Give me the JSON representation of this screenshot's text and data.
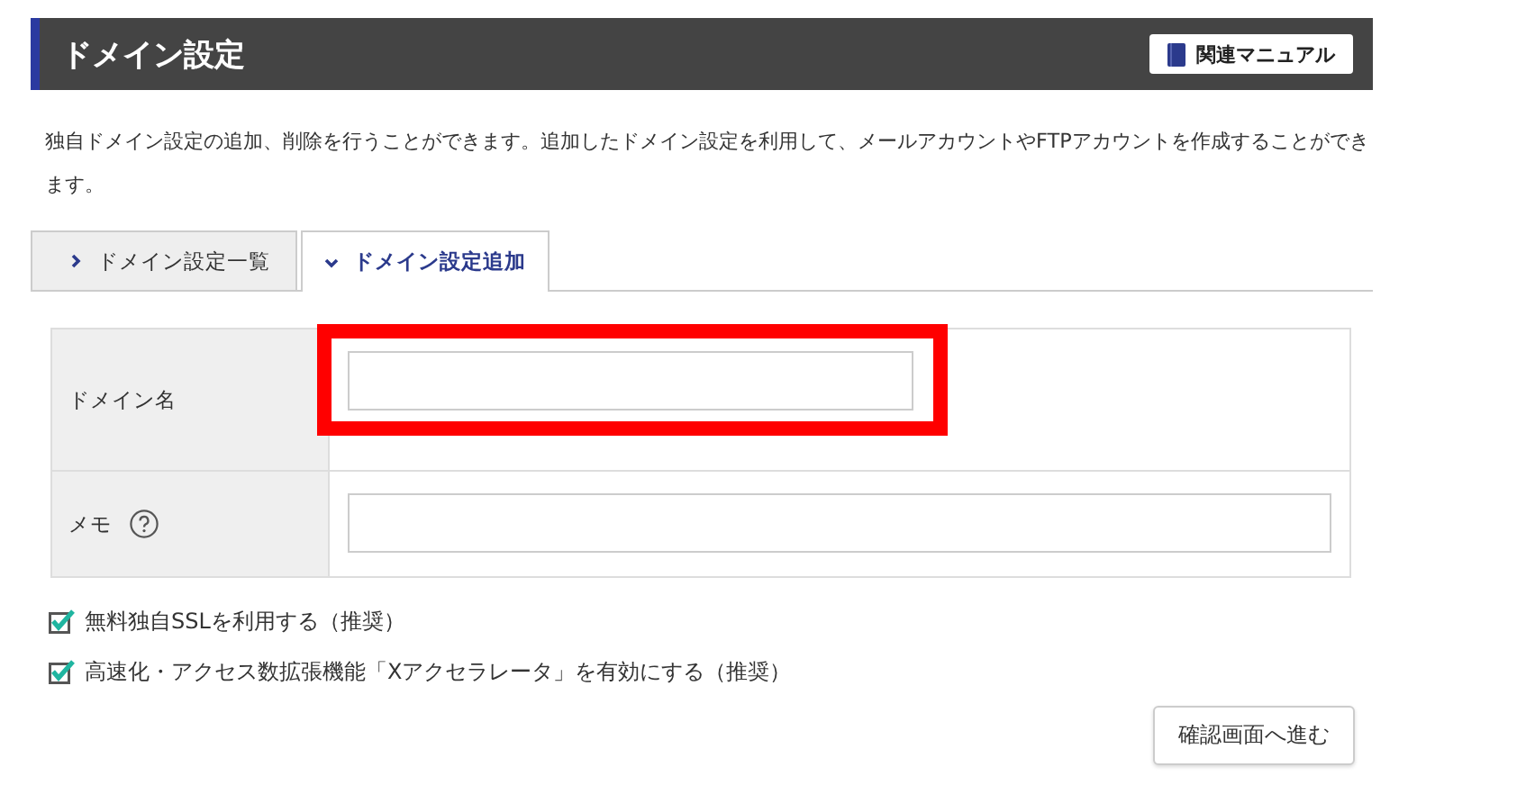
{
  "header": {
    "title": "ドメイン設定",
    "manual_button": "関連マニュアル"
  },
  "description": "独自ドメイン設定の追加、削除を行うことができます。追加したドメイン設定を利用して、メールアカウントやFTPアカウントを作成することができます。",
  "tabs": [
    {
      "label": "ドメイン設定一覧",
      "selected": false
    },
    {
      "label": "ドメイン設定追加",
      "selected": true
    }
  ],
  "form": [
    {
      "label": "ドメイン名",
      "help": false,
      "highlighted": true
    },
    {
      "label": "メモ",
      "help": true,
      "highlighted": false
    }
  ],
  "options": [
    {
      "label": "無料独自SSLを利用する（推奨）",
      "checked": true
    },
    {
      "label": "高速化・アクセス数拡張機能「Xアクセラレータ」を有効にする（推奨）",
      "checked": true
    }
  ],
  "submit_button": "確認画面へ進む"
}
